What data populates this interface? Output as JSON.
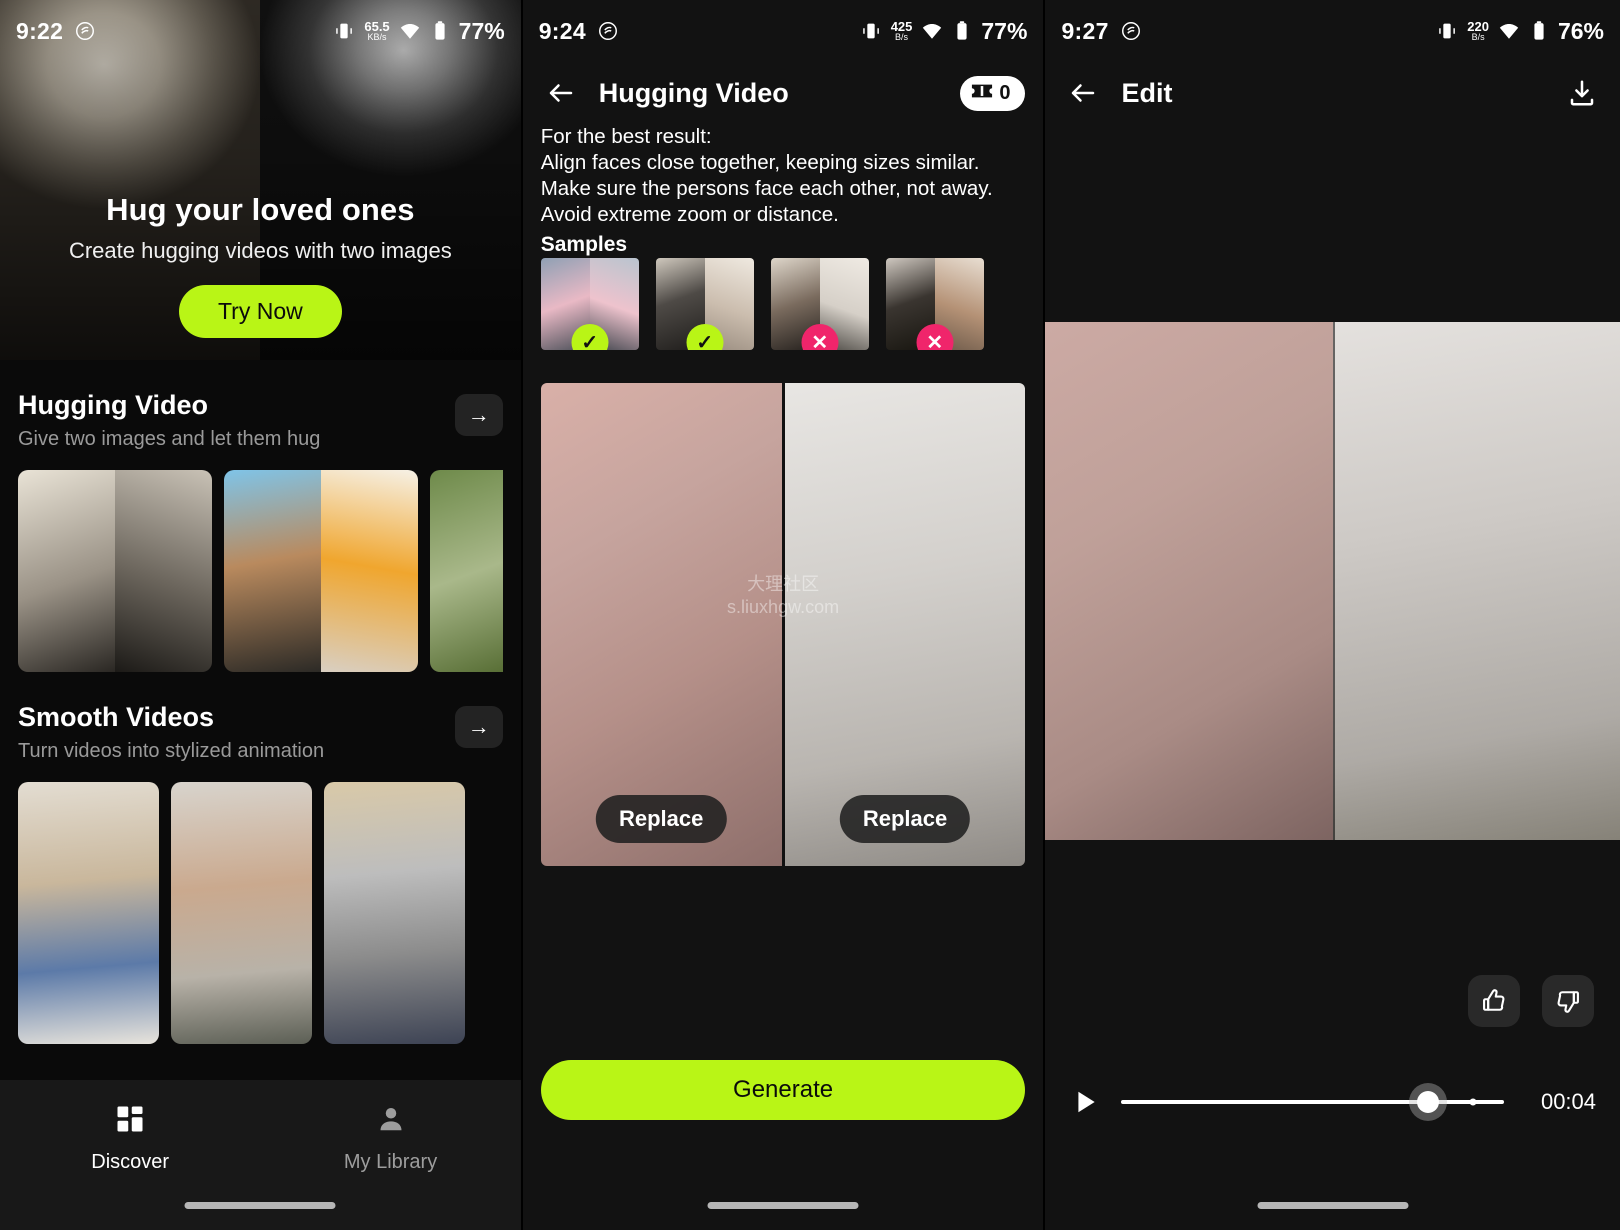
{
  "theme": {
    "accent": "#b9f516",
    "bad": "#f0256b",
    "panel_bg": "#121212",
    "card_bg": "#232323"
  },
  "panel1": {
    "status": {
      "time": "9:22",
      "net_value": "65.5",
      "net_unit": "KB/s",
      "battery": "77%"
    },
    "hero": {
      "title": "Hug your loved ones",
      "subtitle": "Create hugging videos with two images",
      "cta": "Try Now"
    },
    "sections": [
      {
        "title": "Hugging Video",
        "subtitle": "Give two images and let them hug",
        "arrow": "→"
      },
      {
        "title": "Smooth Videos",
        "subtitle": "Turn videos into stylized animation",
        "arrow": "→"
      }
    ],
    "nav": [
      {
        "label": "Discover",
        "icon": "grid-icon",
        "active": true
      },
      {
        "label": "My Library",
        "icon": "person-icon",
        "active": false
      }
    ]
  },
  "panel2": {
    "status": {
      "time": "9:24",
      "net_value": "425",
      "net_unit": "B/s",
      "battery": "77%"
    },
    "appbar": {
      "title": "Hugging Video",
      "back_icon": "back-arrow-icon",
      "credits": "0",
      "credits_icon": "ticket-icon"
    },
    "tips": [
      "For the best result:",
      "Align faces close together, keeping sizes similar.",
      "Make sure the persons face each other, not away.",
      "Avoid extreme zoom or distance."
    ],
    "samples_label": "Samples",
    "samples": [
      {
        "state": "good",
        "mark": "✓"
      },
      {
        "state": "good",
        "mark": "✓"
      },
      {
        "state": "bad",
        "mark": "✕"
      },
      {
        "state": "bad",
        "mark": "✕"
      }
    ],
    "editor": {
      "replace_left": "Replace",
      "replace_right": "Replace",
      "watermark_line1": "大理社区",
      "watermark_line2": "s.liuxhgw.com"
    },
    "generate": "Generate"
  },
  "panel3": {
    "status": {
      "time": "9:27",
      "net_value": "220",
      "net_unit": "B/s",
      "battery": "76%"
    },
    "appbar": {
      "title": "Edit",
      "back_icon": "back-arrow-icon",
      "download_icon": "download-icon"
    },
    "reactions": [
      {
        "icon": "thumbs-up-icon"
      },
      {
        "icon": "thumbs-down-icon"
      }
    ],
    "player": {
      "play_icon": "play-icon",
      "time": "00:04",
      "progress_percent": 80
    }
  }
}
